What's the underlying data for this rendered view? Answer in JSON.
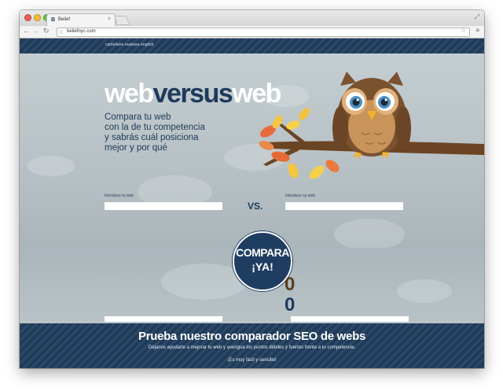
{
  "browser": {
    "tab_favicon": "B",
    "tab_title": "Belief",
    "tab_close": "×",
    "url": "beliefnyc.com",
    "back_icon": "arrow-left",
    "forward_icon": "arrow-right",
    "reload_icon": "reload"
  },
  "header": {
    "languages": "castellano euskara english"
  },
  "hero": {
    "title_web1": "web",
    "title_versus": "versus",
    "title_web2": "web",
    "subtitle_lines": [
      "Compara tu web",
      "con la de tu competencia",
      "y sabrás cuál posiciona",
      "mejor y por qué"
    ]
  },
  "form": {
    "your_web_label": "Introduce tu web",
    "their_web_label": "Introduce su web",
    "vs_label": "VS.",
    "button_line1": "COMPARA",
    "button_line2": "¡YA!"
  },
  "results": {
    "score_left": "0",
    "score_right": "0",
    "score_left_color": "#5a3d1e",
    "score_right_color": "#1d3a5c"
  },
  "footer": {
    "headline": "Prueba nuestro comparador SEO de webs",
    "description": "Déjanos ayudarte a mejorar tu web y averigua los puntos débiles y fuertes frente a tu competencia.",
    "tagline": "¡Es muy fácil y sencillo!"
  },
  "colors": {
    "navy": "#1d3a5c",
    "sky": "#b2bcc0",
    "owl_brown": "#7a5230"
  }
}
